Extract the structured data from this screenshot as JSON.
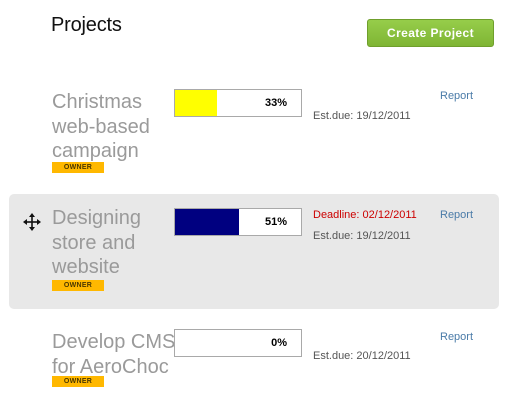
{
  "header": {
    "title": "Projects",
    "create_label": "Create Project",
    "create_color": "#8cc63f"
  },
  "projects": [
    {
      "name": "Christmas web-based campaign",
      "role": "OWNER",
      "progress_label": "33%",
      "progress": 0.33,
      "bar_color": "#ffff00",
      "deadline": "",
      "est_due": "Est.due:  19/12/2011",
      "report_label": "Report"
    },
    {
      "name": "Designing store and website",
      "role": "OWNER",
      "progress_label": "51%",
      "progress": 0.51,
      "bar_color": "#000080",
      "deadline": "Deadline:  02/12/2011",
      "est_due": "Est.due:  19/12/2011",
      "report_label": "Report",
      "highlighted": true,
      "drag_icon": "move-arrows-icon"
    },
    {
      "name": "Develop CMS for AeroChoc",
      "role": "OWNER",
      "progress_label": "0%",
      "progress": 0,
      "bar_color": "#cccccc",
      "deadline": "",
      "est_due": "Est.due:  20/12/2011",
      "report_label": "Report"
    }
  ],
  "colors": {
    "badge": "#ffb800",
    "deadline_text": "#cc0000",
    "link": "#4a7ba8",
    "row_highlight": "#e8e8e8"
  }
}
